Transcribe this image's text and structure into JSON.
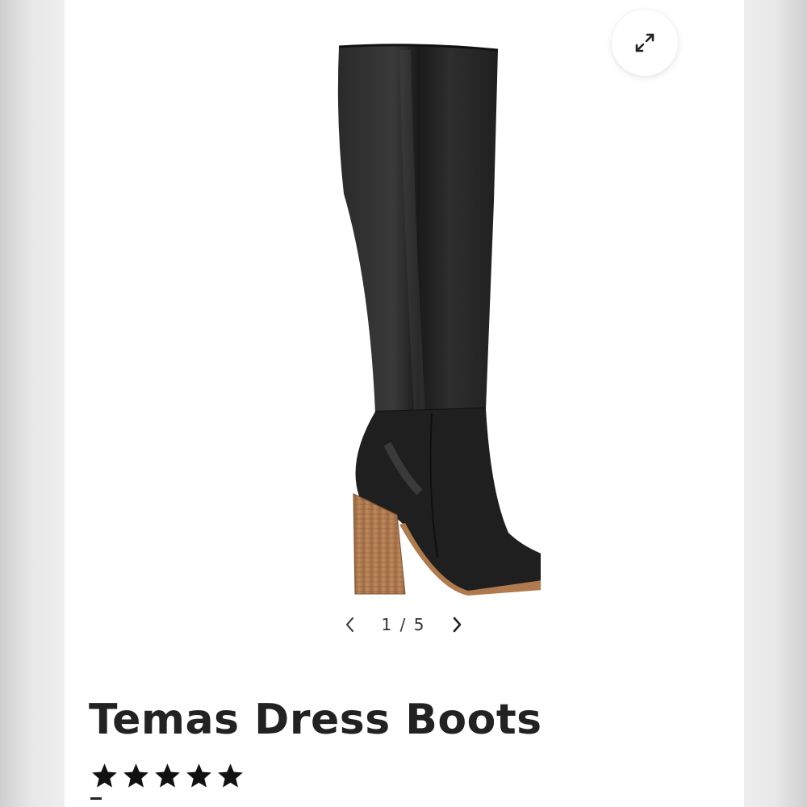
{
  "gallery": {
    "current_index": "1",
    "total": "5",
    "separator": "/",
    "prev_icon": "chevron-left-icon",
    "next_icon": "chevron-right-icon",
    "expand_icon": "expand-arrows-icon",
    "image_subject": "black knee-high leather boot with stacked wood block heel"
  },
  "product": {
    "title": "Temas Dress Boots",
    "rating": 5,
    "rating_max": 5
  },
  "colors": {
    "text": "#222222",
    "boot": "#1f1f1f",
    "heel": "#b07a4f",
    "background": "#ffffff"
  }
}
